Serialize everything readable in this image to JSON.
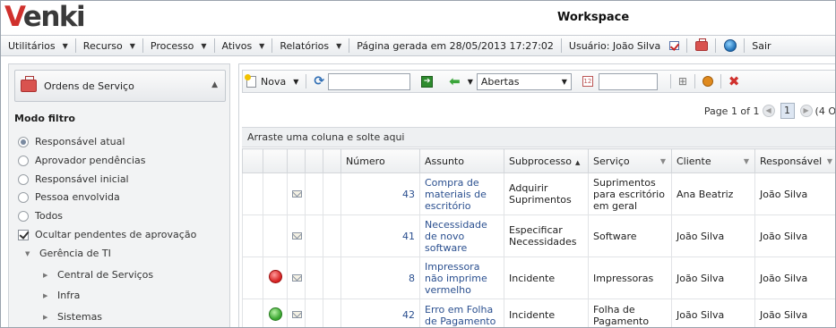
{
  "header": {
    "logo": "venki",
    "title": "Workspace"
  },
  "menu": {
    "items": [
      "Utilitários",
      "Recurso",
      "Processo",
      "Ativos",
      "Relatórios"
    ],
    "generated": "Página gerada em 28/05/2013 17:27:02",
    "user": "Usuário: João Silva",
    "exit": "Sair"
  },
  "sidebar": {
    "panel_title": "Ordens de Serviço",
    "filter_title": "Modo filtro",
    "options": [
      "Responsável atual",
      "Aprovador pendências",
      "Responsável inicial",
      "Pessoa envolvida",
      "Todos"
    ],
    "selected_option": "Responsável atual",
    "hide_pending_label": "Ocultar pendentes de aprovação",
    "hide_pending_checked": true,
    "tree_root": "Gerência de TI",
    "tree_children": [
      "Central de Serviços",
      "Infra",
      "Sistemas"
    ]
  },
  "toolbar": {
    "new_label": "Nova",
    "search_value": "",
    "status_value": "Abertas",
    "date_value": ""
  },
  "pager": {
    "text": "Page 1 of 1",
    "current_page": "1",
    "count": "(4 O"
  },
  "group_bar": "Arraste uma coluna e solte aqui",
  "table": {
    "columns": [
      "Número",
      "Assunto",
      "Subprocesso",
      "Serviço",
      "Cliente",
      "Responsável"
    ],
    "rows": [
      {
        "status": "",
        "numero": "43",
        "assunto": "Compra de materiais de escritório",
        "subprocesso": "Adquirir Suprimentos",
        "servico": "Suprimentos para escritório em geral",
        "cliente": "Ana Beatriz",
        "responsavel": "João Silva"
      },
      {
        "status": "",
        "numero": "41",
        "assunto": "Necessidade de novo software",
        "subprocesso": "Especificar Necessidades",
        "servico": "Software",
        "cliente": "João Silva",
        "responsavel": "João Silva"
      },
      {
        "status": "red",
        "numero": "8",
        "assunto": "Impressora não imprime vermelho",
        "subprocesso": "Incidente",
        "servico": "Impressoras",
        "cliente": "João Silva",
        "responsavel": "João Silva"
      },
      {
        "status": "green",
        "numero": "42",
        "assunto": "Erro em Folha de Pagamento",
        "subprocesso": "Incidente",
        "servico": "Folha de Pagamento",
        "cliente": "João Silva",
        "responsavel": "João Silva"
      }
    ]
  },
  "colors": {
    "brand_red": "#d0312d",
    "link_blue": "#2a4f8f",
    "status_red": "#d62222",
    "status_green": "#3ba631"
  }
}
